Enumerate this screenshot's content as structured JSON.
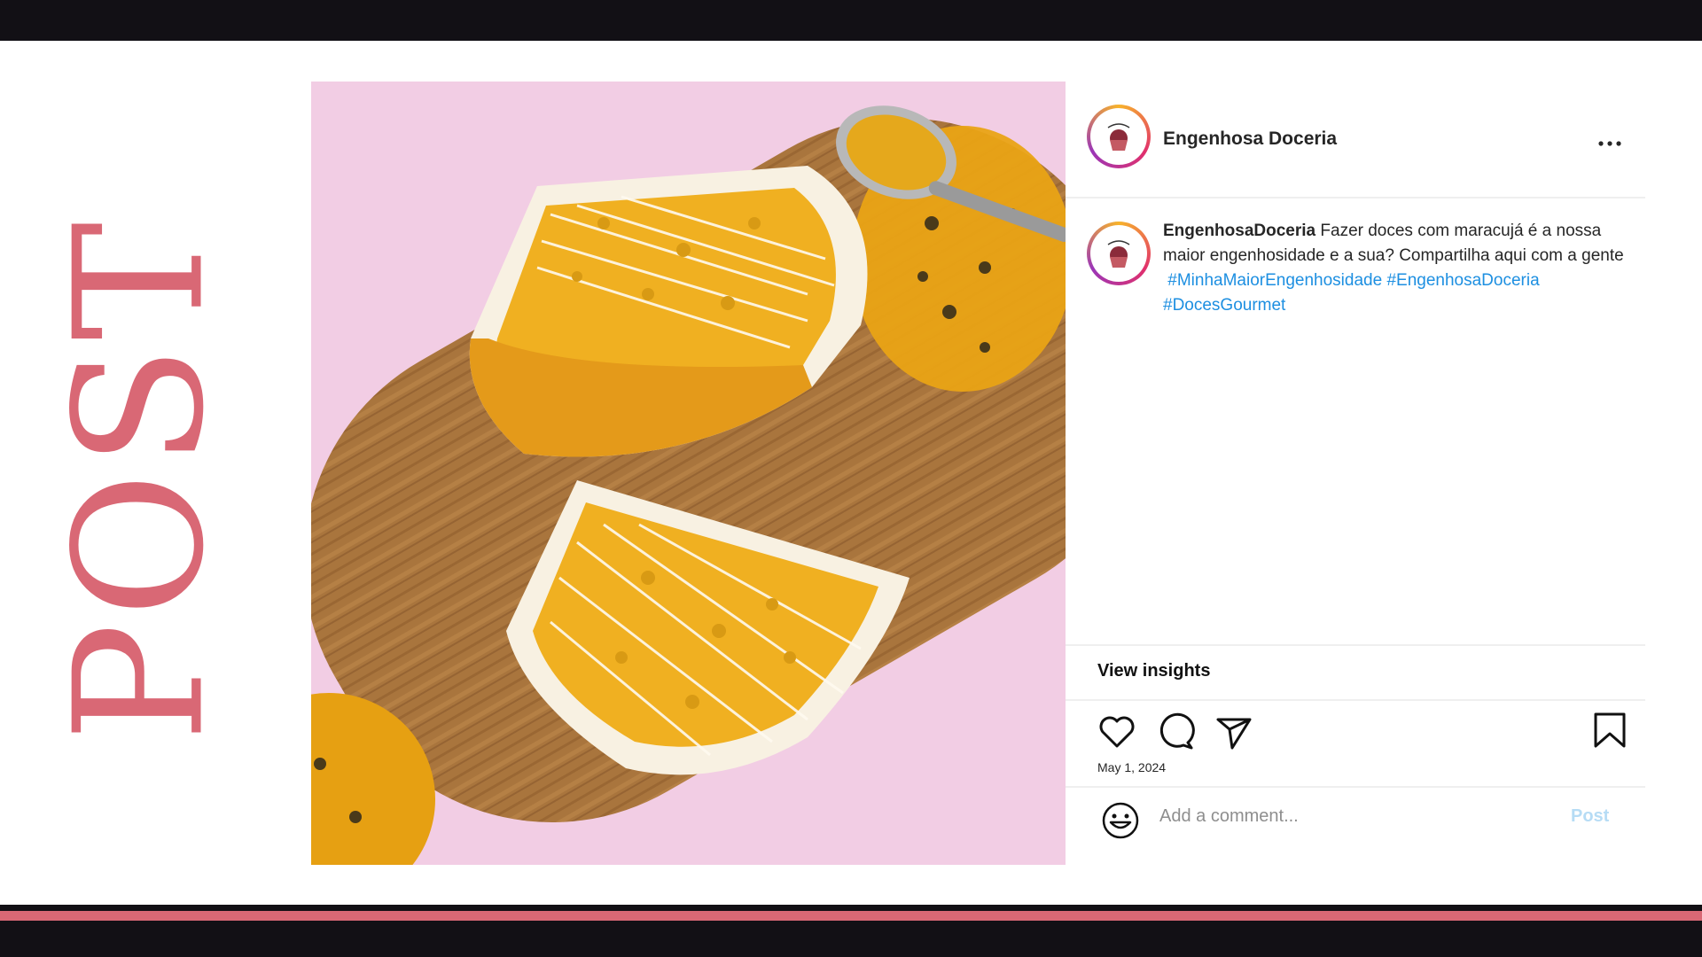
{
  "slide": {
    "side_title": "POST",
    "colors": {
      "accent": "#d96875",
      "dark": "#121015",
      "photo_background": "#f2cde4"
    }
  },
  "post": {
    "photo_alt": "Passion fruit tart slices on a wooden board",
    "author": {
      "display_name": "Engenhosa Doceria",
      "username": "EngenhosaDoceria",
      "avatar_icon": "cupcake-logo"
    },
    "more_icon": "more-horizontal-icon",
    "caption": {
      "username": "EngenhosaDoceria",
      "text": "Fazer doces com maracujá é a nossa maior engenhosidade e a sua? Compartilha aqui com a gente",
      "hashtags": [
        "#MinhaMaiorEngenhosidade",
        "#EngenhosaDoceria",
        "#DocesGourmet"
      ]
    },
    "insights_label": "View insights",
    "actions": {
      "like_icon": "heart-icon",
      "comment_icon": "comment-icon",
      "share_icon": "send-icon",
      "save_icon": "bookmark-icon"
    },
    "date": "May 1, 2024",
    "comment": {
      "placeholder": "Add a comment...",
      "value": "",
      "post_label": "Post",
      "emoji_icon": "smiley-icon"
    },
    "colors": {
      "hashtag": "#1d8fe1",
      "post_button": "#b6dcf5",
      "divider": "#efefef"
    }
  }
}
